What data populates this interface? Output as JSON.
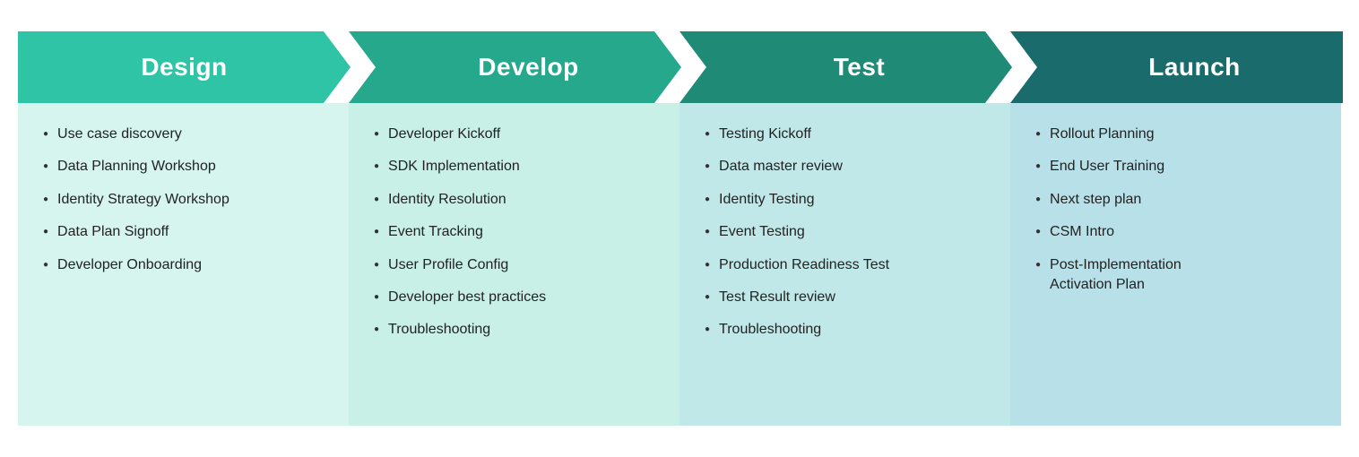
{
  "phases": [
    {
      "id": "design",
      "header_label": "Design",
      "header_class": "h-design",
      "content_class": "c-design",
      "items": [
        "Use case discovery",
        "Data Planning Workshop",
        "Identity Strategy Workshop",
        "Data Plan Signoff",
        "Developer Onboarding"
      ]
    },
    {
      "id": "develop",
      "header_label": "Develop",
      "header_class": "h-develop",
      "content_class": "c-develop",
      "items": [
        "Developer Kickoff",
        "SDK  Implementation",
        "Identity Resolution",
        "Event Tracking",
        "User Profile Config",
        "Developer best practices",
        "Troubleshooting"
      ]
    },
    {
      "id": "test",
      "header_label": "Test",
      "header_class": "h-test",
      "content_class": "c-test",
      "items": [
        "Testing Kickoff",
        "Data master review",
        "Identity Testing",
        "Event Testing",
        "Production Readiness Test",
        "Test Result review",
        "Troubleshooting"
      ]
    },
    {
      "id": "launch",
      "header_label": "Launch",
      "header_class": "h-launch",
      "content_class": "c-launch",
      "items": [
        "Rollout Planning",
        "End User Training",
        "Next step plan",
        "CSM Intro",
        "Post-Implementation\nActivation Plan"
      ]
    }
  ]
}
